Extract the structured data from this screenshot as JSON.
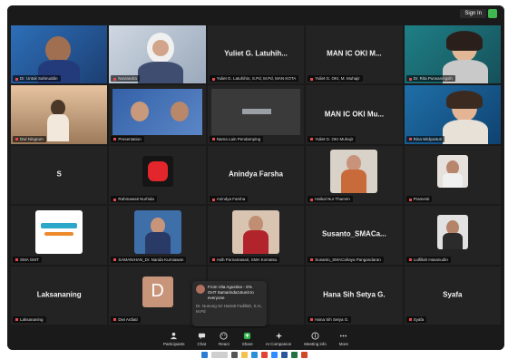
{
  "topbar": {
    "signin_label": "Sign In"
  },
  "tiles": [
    {
      "label": "Dr. Untuk Sahiruddin",
      "type": "video"
    },
    {
      "label": "Noviandra",
      "type": "video"
    },
    {
      "name": "Yuliet G. Latuhih...",
      "label": "Yuliet G. Latuhihin, S.Pd, M.Pd, MAN KOTA",
      "type": "name"
    },
    {
      "name": "MAN IC OKI M...",
      "label": "Yuliet G. OKI, M. Muhajir",
      "type": "name"
    },
    {
      "label": "Dr. Rita Purwaningsih",
      "type": "video",
      "active": true
    },
    {
      "label": "Dwi Ningrum",
      "type": "video"
    },
    {
      "label": "Presentation",
      "type": "slide"
    },
    {
      "label": "Nama Lain Pendamping",
      "type": "slide"
    },
    {
      "name": "MAN IC OKI Mu...",
      "label": "Yuliet G. OKI Muhajir",
      "type": "name"
    },
    {
      "label": "Rina Widyastuti",
      "type": "video"
    },
    {
      "name": "S",
      "label": "",
      "type": "name"
    },
    {
      "label": "Rahmawati Nurhida",
      "type": "video"
    },
    {
      "name": "Anindya Farsha",
      "label": "Anindya Farsha",
      "type": "name"
    },
    {
      "label": "Haikal Nur Thamrin",
      "type": "video"
    },
    {
      "label": "Pramesti",
      "type": "video"
    },
    {
      "label": "SMA GMT",
      "type": "video"
    },
    {
      "label": "SAMANIHAN_Dr. Nanda Kurniawan",
      "type": "video"
    },
    {
      "label": "Asih Purnamasari, SMA Komatsu",
      "type": "video"
    },
    {
      "name": "Susanto_SMACa...",
      "label": "Susanto_SMACahaya Pangandaran",
      "type": "name"
    },
    {
      "label": "Lutfillah Hasanudin",
      "type": "video"
    },
    {
      "name": "Laksananing",
      "label": "Laksananing",
      "type": "name"
    },
    {
      "label": "Dwi Ardiati",
      "type": "avatar",
      "initial": "D"
    },
    {
      "label": "",
      "type": "empty"
    },
    {
      "name": "Hana Sih Setya G.",
      "label": "Hana Sih Setya G.",
      "type": "name"
    },
    {
      "name": "Syafa",
      "label": "Syafa",
      "type": "name"
    }
  ],
  "chat_popup": {
    "sender": "From Vita Agustina - S%",
    "message": "GHT Samarinda1stunit to everyone",
    "footer": "Dr. Nunung Sri Hartati Fadillah, S.H., M.Pd"
  },
  "toolbar": [
    {
      "label": "Participants",
      "icon": "participants-icon"
    },
    {
      "label": "Chat",
      "icon": "chat-icon"
    },
    {
      "label": "React",
      "icon": "react-icon"
    },
    {
      "label": "Share",
      "icon": "share-icon"
    },
    {
      "label": "AI Companion",
      "icon": "ai-companion-icon"
    },
    {
      "label": "Meeting info",
      "icon": "info-icon"
    },
    {
      "label": "More",
      "icon": "more-icon"
    }
  ],
  "colors": {
    "active_border": "#2fb24a",
    "tile_bg": "#232323",
    "muted_icon": "#e5484d"
  }
}
